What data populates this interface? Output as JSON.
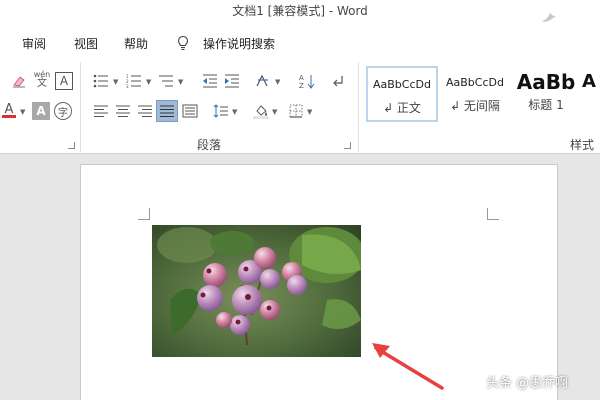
{
  "window": {
    "title": "文档1 [兼容模式]  -  Word"
  },
  "menu": {
    "tabs": [
      "审阅",
      "视图",
      "帮助"
    ],
    "tell_me": "操作说明搜索"
  },
  "ribbon": {
    "groups": {
      "paragraph": "段落",
      "styles": "样式"
    },
    "phonetic_icon_text": {
      "top": "wén",
      "bottom": "文"
    },
    "enclose_char": "字",
    "font_color_letter": "A",
    "char_shading_letter": "A",
    "char_border_letter": "A",
    "styles": [
      {
        "sample": "AaBbCcDd",
        "name": "↲ 正文"
      },
      {
        "sample": "AaBbCcDd",
        "name": "↲ 无间隔"
      },
      {
        "sample": "AaBb",
        "name": "标题 1"
      },
      {
        "sample": "A",
        "name": ""
      }
    ]
  },
  "watermark": {
    "text": "头条 @愚乔啊"
  },
  "colors": {
    "accent_red": "#e03030",
    "arrow_red": "#e84040",
    "selected_style_border": "#bcd4ee",
    "shading_highlight": "#9fb9d6"
  }
}
